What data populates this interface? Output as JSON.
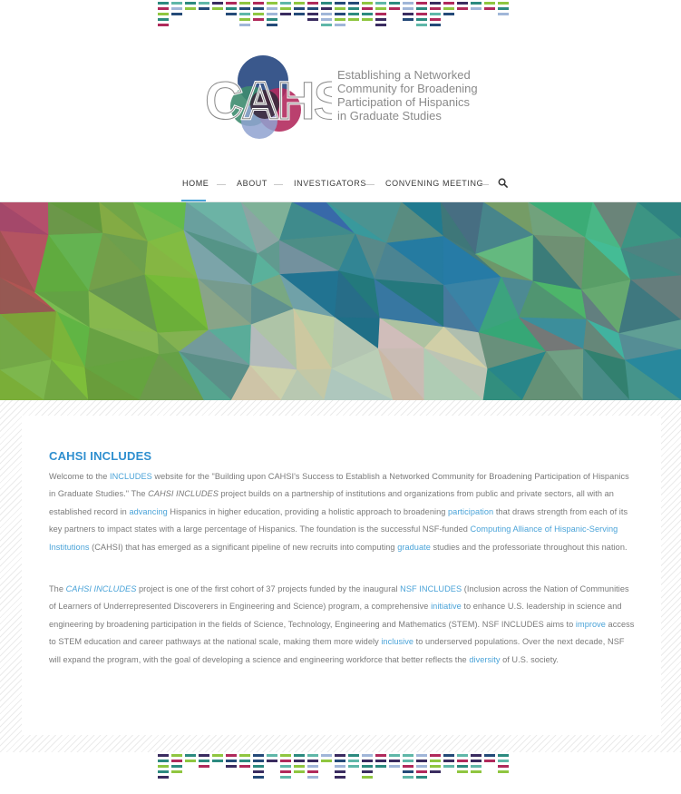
{
  "colors": {
    "accent": "#4aa3d8",
    "title": "#2f8fcf",
    "text": "#7a7a7a",
    "dash_palette": [
      "#b02a5b",
      "#244a78",
      "#8fc640",
      "#5fb7a8",
      "#a0b6d8",
      "#3a2c60",
      "#2c8a7f"
    ]
  },
  "logo": {
    "wordmark": "CAHSI",
    "tagline": [
      "Establishing a Networked",
      "Community for Broadening",
      "Participation of Hispanics",
      "in Graduate Studies"
    ]
  },
  "nav": {
    "items": [
      {
        "label": "HOME",
        "active": true
      },
      {
        "label": "ABOUT",
        "active": false
      },
      {
        "label": "INVESTIGATORS",
        "active": false
      },
      {
        "label": "CONVENING MEETING",
        "active": false
      }
    ],
    "search_icon": "search-icon"
  },
  "hero": {
    "description": "low-poly-green-teal-banner"
  },
  "content": {
    "title": "CAHSI INCLUDES",
    "p1": {
      "s1": "Welcome to the ",
      "l1": "INCLUDES",
      "s2": " website for the \"Building upon CAHSI's Success to Establish a Networked Community for Broadening Participation of Hispanics in Graduate Studies.\"  The ",
      "e1": "CAHSI INCLUDES",
      "s3": " project builds on a partnership of institutions and organizations from public and private sectors, all with an established record in ",
      "l2": "advancing",
      "s4": " Hispanics in higher education, providing a holistic approach to broadening ",
      "l3": "participation",
      "s5": " that draws strength from each of its key partners to impact states with a large percentage of Hispanics. The foundation is the successful NSF-funded ",
      "l4": "Computing Alliance of Hispanic-Serving Institutions",
      "s6": " (CAHSI) that has emerged as a significant pipeline of new recruits into computing ",
      "l5": "graduate",
      "s7": " studies and the professoriate throughout this nation."
    },
    "p2": {
      "s1": "The ",
      "l1": "CAHSI INCLUDES",
      "s2": " project is one of the first cohort of 37 projects funded by the inaugural ",
      "l2": "NSF INCLUDES",
      "s3": " (Inclusion across the Nation of Communities of Learners of Underrepresented Discoverers in Engineering and Science) program, a comprehensive ",
      "l3": "initiative",
      "s4": " to enhance U.S. leadership in science and engineering by broadening participation in the fields of Science, Technology, Engineering and Mathematics (STEM).  NSF INCLUDES aims to ",
      "l4": "improve",
      "s5": " access to STEM education and career pathways at the national scale, making them more widely ",
      "l5": "inclusive",
      "s6": " to underserved populations. Over the next decade, NSF will expand the program, with the goal of developing a science and engineering workforce that better reflects the ",
      "l6": "diversity",
      "s7": " of U.S. society."
    }
  }
}
